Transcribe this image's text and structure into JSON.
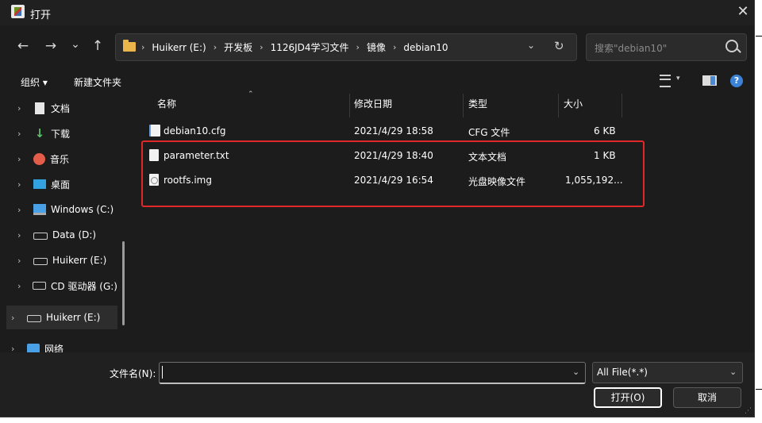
{
  "window": {
    "title": "打开",
    "close_glyph": "✕"
  },
  "nav": {
    "back": "←",
    "forward": "→",
    "recent": "⌄",
    "up": "↑"
  },
  "address": {
    "crumbs": [
      "Huikerr (E:)",
      "开发板",
      "1126JD4学习文件",
      "镜像",
      "debian10"
    ],
    "separator": "›",
    "dropdown": "⌄",
    "refresh": "↻"
  },
  "search": {
    "placeholder": "搜索\"debian10\""
  },
  "toolbar": {
    "organize": "组织 ▾",
    "new_folder": "新建文件夹"
  },
  "sidebar": {
    "items": [
      {
        "label": "文档",
        "icon": "document-icon"
      },
      {
        "label": "下载",
        "icon": "download-icon"
      },
      {
        "label": "音乐",
        "icon": "music-icon"
      },
      {
        "label": "桌面",
        "icon": "desktop-icon"
      },
      {
        "label": "Windows (C:)",
        "icon": "windows-drive-icon"
      },
      {
        "label": "Data (D:)",
        "icon": "drive-icon"
      },
      {
        "label": "Huikerr (E:)",
        "icon": "drive-icon"
      },
      {
        "label": "CD 驱动器 (G:)",
        "icon": "cd-drive-icon"
      },
      {
        "label": "Huikerr (E:)",
        "icon": "drive-icon",
        "selected": true
      },
      {
        "label": "网络",
        "icon": "network-icon"
      }
    ],
    "chevron": "›"
  },
  "columns": {
    "name": "名称",
    "date": "修改日期",
    "type": "类型",
    "size": "大小"
  },
  "files": [
    {
      "name": "debian10.cfg",
      "date": "2021/4/29 18:58",
      "type": "CFG 文件",
      "size": "6 KB",
      "icon": "cfg-file-icon"
    },
    {
      "name": "parameter.txt",
      "date": "2021/4/29 18:40",
      "type": "文本文档",
      "size": "1 KB",
      "icon": "text-file-icon"
    },
    {
      "name": "rootfs.img",
      "date": "2021/4/29 16:54",
      "type": "光盘映像文件",
      "size": "1,055,192...",
      "icon": "disc-image-icon"
    }
  ],
  "bottom": {
    "filename_label": "文件名(N):",
    "filename_value": "",
    "filetype": "All File(*.*)",
    "open": "打开(O)",
    "cancel": "取消"
  },
  "colors": {
    "highlight": "#e02828",
    "background": "#1c1c1c",
    "accent": "#3b82d6"
  }
}
